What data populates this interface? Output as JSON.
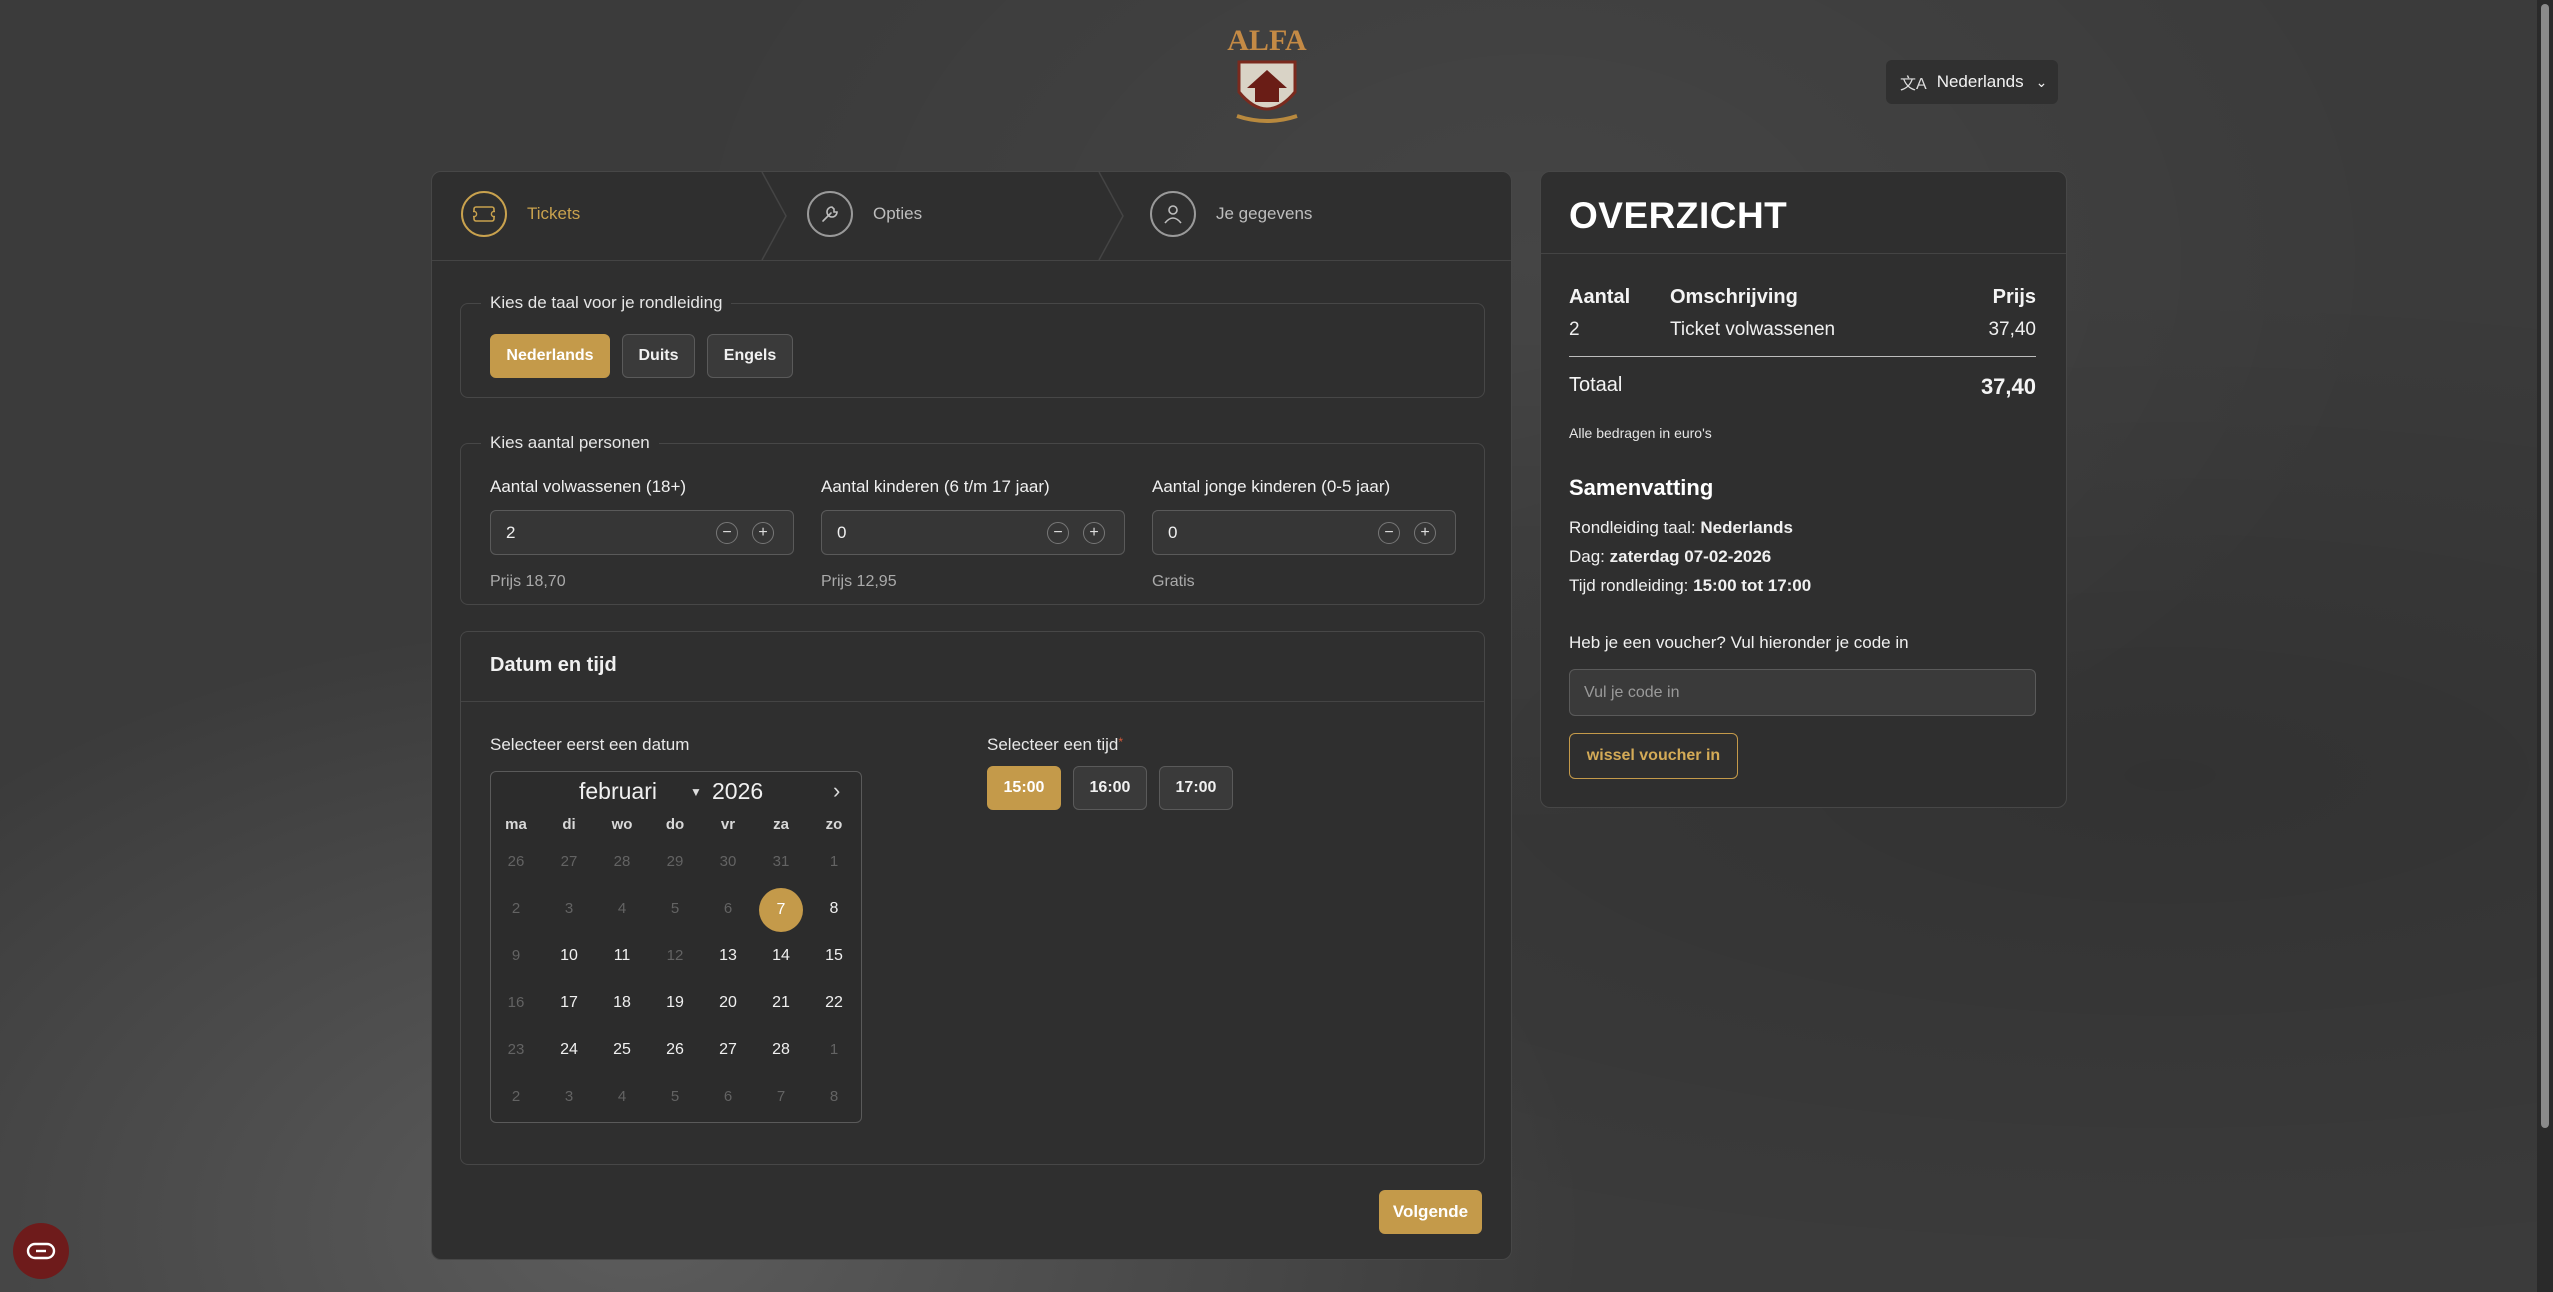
{
  "header": {
    "logo_text": "ALFA",
    "language_selector": "Nederlands"
  },
  "steps": [
    {
      "label": "Tickets",
      "active": true
    },
    {
      "label": "Opties",
      "active": false
    },
    {
      "label": "Je gegevens",
      "active": false
    }
  ],
  "tour_language": {
    "legend": "Kies de taal voor je rondleiding",
    "options": [
      "Nederlands",
      "Duits",
      "Engels"
    ],
    "selected": "Nederlands"
  },
  "persons": {
    "legend": "Kies aantal personen",
    "adults": {
      "label": "Aantal volwassenen (18+)",
      "value": "2",
      "price": "Prijs 18,70"
    },
    "children": {
      "label": "Aantal kinderen (6 t/m 17 jaar)",
      "value": "0",
      "price": "Prijs 12,95"
    },
    "young_children": {
      "label": "Aantal jonge kinderen (0-5 jaar)",
      "value": "0",
      "price": "Gratis"
    }
  },
  "datetime": {
    "title": "Datum en tijd",
    "date_label": "Selecteer eerst een datum",
    "time_label": "Selecteer een tijd",
    "required_mark": "*",
    "month": "februari",
    "year": "2026",
    "weekdays": [
      "ma",
      "di",
      "wo",
      "do",
      "vr",
      "za",
      "zo"
    ],
    "weeks": [
      [
        "26",
        "27",
        "28",
        "29",
        "30",
        "31",
        "1"
      ],
      [
        "2",
        "3",
        "4",
        "5",
        "6",
        "7",
        "8"
      ],
      [
        "9",
        "10",
        "11",
        "12",
        "13",
        "14",
        "15"
      ],
      [
        "16",
        "17",
        "18",
        "19",
        "20",
        "21",
        "22"
      ],
      [
        "23",
        "24",
        "25",
        "26",
        "27",
        "28",
        "1"
      ],
      [
        "2",
        "3",
        "4",
        "5",
        "6",
        "7",
        "8"
      ]
    ],
    "selected_day": "7",
    "times": [
      "15:00",
      "16:00",
      "17:00"
    ],
    "selected_time": "15:00"
  },
  "next_button": "Volgende",
  "overview": {
    "title": "OVERZICHT",
    "col_qty": "Aantal",
    "col_desc": "Omschrijving",
    "col_price": "Prijs",
    "row_qty": "2",
    "row_desc": "Ticket volwassenen",
    "row_price": "37,40",
    "total_label": "Totaal",
    "total_value": "37,40",
    "note": "Alle bedragen in euro's",
    "summary_title": "Samenvatting",
    "summary": [
      {
        "label": "Rondleiding taal: ",
        "value": "Nederlands"
      },
      {
        "label": "Dag: ",
        "value": "zaterdag 07-02-2026"
      },
      {
        "label": "Tijd rondleiding: ",
        "value": "15:00 tot 17:00"
      }
    ],
    "voucher_label": "Heb je een voucher? Vul hieronder je code in",
    "voucher_placeholder": "Vul je code in",
    "voucher_button": "wissel voucher in"
  },
  "colors": {
    "accent": "#c49a4a",
    "card": "#2f2f2f",
    "background": "#3b3b3b"
  }
}
